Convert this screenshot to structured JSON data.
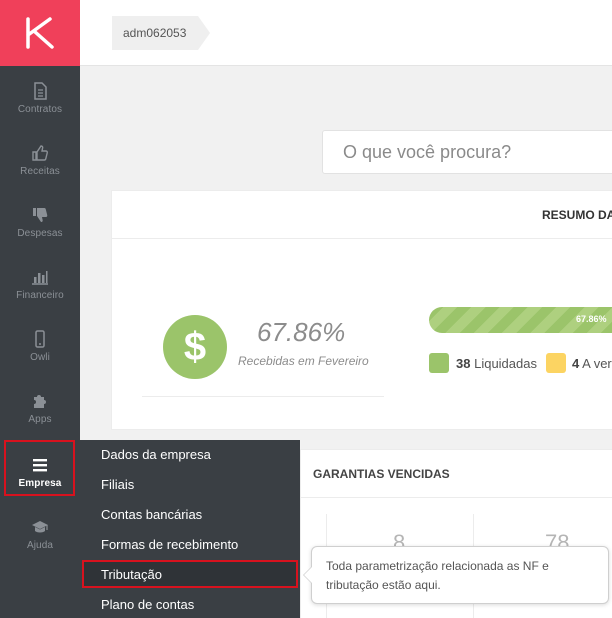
{
  "breadcrumb": {
    "user": "adm062053"
  },
  "sidebar": {
    "items": [
      {
        "label": "Contratos",
        "icon": "document-icon"
      },
      {
        "label": "Receitas",
        "icon": "thumbs-up-icon"
      },
      {
        "label": "Despesas",
        "icon": "thumbs-down-icon"
      },
      {
        "label": "Financeiro",
        "icon": "bar-chart-icon"
      },
      {
        "label": "Owli",
        "icon": "mobile-icon"
      },
      {
        "label": "Apps",
        "icon": "puzzle-icon"
      },
      {
        "label": "Empresa",
        "icon": "menu-icon",
        "active": true
      },
      {
        "label": "Ajuda",
        "icon": "graduation-cap-icon"
      }
    ]
  },
  "search": {
    "placeholder": "O que você procura?"
  },
  "summary": {
    "title": "RESUMO DA",
    "percent": "67.86%",
    "percent_caption": "Recebidas em Fevereiro",
    "progress_label": "67.86%",
    "progress_value": 67.86,
    "legend": [
      {
        "count": "38",
        "label": "Liquidadas",
        "color": "#9bc46a"
      },
      {
        "count": "4",
        "label": "A ver",
        "color": "#fcd462"
      }
    ]
  },
  "garantias": {
    "title": "GARANTIAS VENCIDAS",
    "values": [
      "8",
      "78"
    ]
  },
  "menu": {
    "items": [
      "Dados da empresa",
      "Filiais",
      "Contas bancárias",
      "Formas de recebimento",
      "Tributação",
      "Plano de contas"
    ],
    "highlighted_index": 4
  },
  "tooltip": {
    "line1": "Toda parametrização relacionada as NF e",
    "line2": "tributação estão aqui."
  },
  "colors": {
    "brand": "#f0405a",
    "sidebar": "#3a3f44",
    "success": "#9bc46a",
    "warning": "#fcd462",
    "highlight": "#d8121e"
  }
}
